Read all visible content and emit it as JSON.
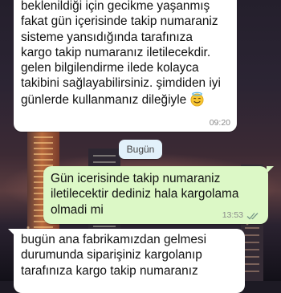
{
  "chat": {
    "messages": [
      {
        "direction": "incoming",
        "lines": [
          "beklenildiği için gecikme yaşanmış",
          "fakat gün içerisinde takip numaraniz",
          "sisteme yansıdığında tarafınıza",
          "kargo takip numaranız iletilecekdir.",
          "gelen bilgilendirme ilede kolayca",
          "takibini sağlayabilirsiniz. şimdiden iyi",
          "günlerde kullanmanız dileğiyle"
        ],
        "emoji": "smiling-face-with-halo-icon",
        "time": "09:20"
      },
      {
        "direction": "outgoing",
        "lines": [
          "Gün icerisinde takip numaraniz",
          "iletilecektir dediniz hala kargolama",
          "olmadi mi"
        ],
        "time": "13:53",
        "status": "read-double-check-icon"
      },
      {
        "direction": "incoming",
        "lines": [
          "bugün ana fabrikamızdan gelmesi",
          "durumunda siparişiniz kargolanıp",
          "tarafınıza kargo takip numaranız"
        ]
      }
    ],
    "date_separator": "Bugün"
  },
  "colors": {
    "incoming_bubble": "#ffffff",
    "outgoing_bubble": "#dcf8c6",
    "read_ticks": "#7a9a8a",
    "date_pill": "#e2f1fa"
  }
}
